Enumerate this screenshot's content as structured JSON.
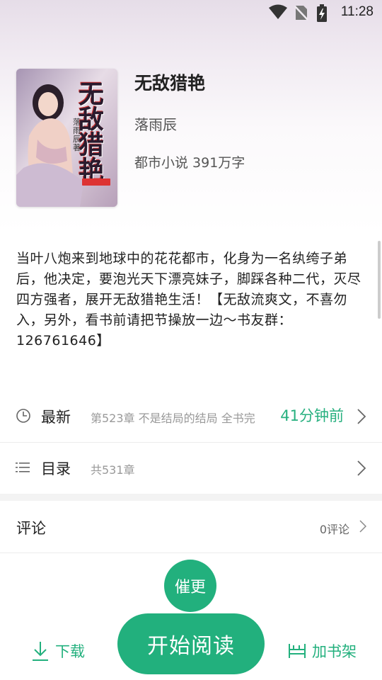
{
  "status_bar": {
    "time": "11:28",
    "icons": [
      "wifi-icon",
      "no-sim-icon",
      "battery-charging-icon"
    ]
  },
  "book": {
    "cover_title": "无敌猎艳",
    "cover_author": "落雨辰著",
    "title": "无敌猎艳",
    "author": "落雨辰",
    "genre": "都市小说",
    "word_count": "391万字",
    "synopsis": "当叶八炮来到地球中的花花都市，化身为一名纨绔子弟后，他决定，要泡光天下漂亮妹子，脚踩各种二代，灭尽四方强者，展开无敌猎艳生活！【无敌流爽文，不喜勿入，另外，看书前请把节操放一边～书友群：126761646】"
  },
  "latest": {
    "label": "最新",
    "chapter": "第523章 不是结局的结局 全书完",
    "time": "41分钟前",
    "icon": "clock-icon"
  },
  "catalog": {
    "label": "目录",
    "count": "共531章",
    "icon": "list-icon"
  },
  "comments": {
    "label": "评论",
    "count": "0评论"
  },
  "actions": {
    "urge": "催更",
    "start_reading": "开始阅读",
    "download": "下载",
    "add_shelf": "加书架"
  },
  "colors": {
    "accent": "#22b07d",
    "time_text": "#27b07f"
  }
}
